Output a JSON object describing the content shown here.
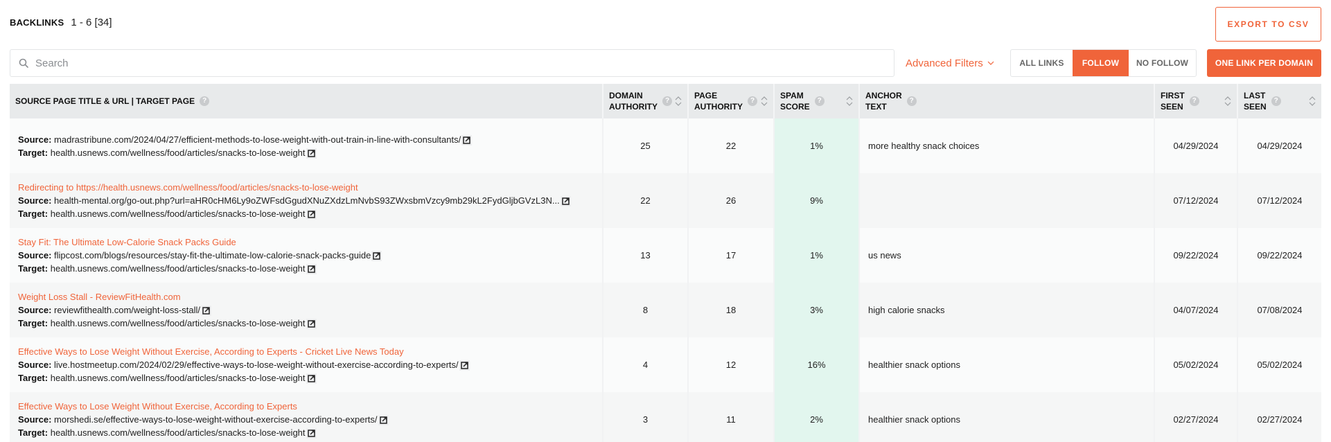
{
  "header": {
    "title": "BACKLINKS",
    "range": "1 - 6 [34]"
  },
  "toolbar": {
    "export_label": "EXPORT TO CSV",
    "search_placeholder": "Search",
    "search_value": "",
    "advanced_filters_label": "Advanced Filters",
    "link_filter": {
      "options": [
        "ALL LINKS",
        "FOLLOW",
        "NO FOLLOW"
      ],
      "selected": "FOLLOW"
    },
    "one_link_label": "ONE LINK PER DOMAIN"
  },
  "colors": {
    "accent": "#f0643a",
    "header_bg": "#e8eaeb",
    "spam_col_bg": "#e2f6ee"
  },
  "table": {
    "columns": [
      {
        "label": "SOURCE PAGE TITLE & URL | TARGET PAGE",
        "help": true,
        "sortable": false
      },
      {
        "label_1": "DOMAIN",
        "label_2": "AUTHORITY",
        "help": true,
        "sortable": true
      },
      {
        "label_1": "PAGE",
        "label_2": "AUTHORITY",
        "help": true,
        "sortable": true
      },
      {
        "label_1": "SPAM",
        "label_2": "SCORE",
        "help": true,
        "sortable": true
      },
      {
        "label_1": "ANCHOR",
        "label_2": "TEXT",
        "help": true,
        "sortable": false
      },
      {
        "label_1": "FIRST",
        "label_2": "SEEN",
        "help": true,
        "sortable": true
      },
      {
        "label_1": "LAST",
        "label_2": "SEEN",
        "help": true,
        "sortable": true
      }
    ],
    "source_label": "Source:",
    "target_label": "Target:",
    "rows": [
      {
        "title": "",
        "source": "madrastribune.com/2024/04/27/efficient-methods-to-lose-weight-with-out-train-in-line-with-consultants/",
        "target": "health.usnews.com/wellness/food/articles/snacks-to-lose-weight",
        "domain_authority": "25",
        "page_authority": "22",
        "spam_score": "1%",
        "anchor_text": "more healthy snack choices",
        "first_seen": "04/29/2024",
        "last_seen": "04/29/2024"
      },
      {
        "title": "Redirecting to https://health.usnews.com/wellness/food/articles/snacks-to-lose-weight",
        "source": "health-mental.org/go-out.php?url=aHR0cHM6Ly9oZWFsdGgudXNuZXdzLmNvbS93ZWxsbmVzcy9mb29kL2FydGljbGVzL3N...",
        "target": "health.usnews.com/wellness/food/articles/snacks-to-lose-weight",
        "domain_authority": "22",
        "page_authority": "26",
        "spam_score": "9%",
        "anchor_text": "",
        "first_seen": "07/12/2024",
        "last_seen": "07/12/2024"
      },
      {
        "title": "Stay Fit: The Ultimate Low-Calorie Snack Packs Guide",
        "source": "flipcost.com/blogs/resources/stay-fit-the-ultimate-low-calorie-snack-packs-guide",
        "target": "health.usnews.com/wellness/food/articles/snacks-to-lose-weight",
        "domain_authority": "13",
        "page_authority": "17",
        "spam_score": "1%",
        "anchor_text": "us news",
        "first_seen": "09/22/2024",
        "last_seen": "09/22/2024"
      },
      {
        "title": "Weight Loss Stall - ReviewFitHealth.com",
        "source": "reviewfithealth.com/weight-loss-stall/",
        "target": "health.usnews.com/wellness/food/articles/snacks-to-lose-weight",
        "domain_authority": "8",
        "page_authority": "18",
        "spam_score": "3%",
        "anchor_text": "high calorie snacks",
        "first_seen": "04/07/2024",
        "last_seen": "07/08/2024"
      },
      {
        "title": "Effective Ways to Lose Weight Without Exercise, According to Experts - Cricket Live News Today",
        "source": "live.hostmeetup.com/2024/02/29/effective-ways-to-lose-weight-without-exercise-according-to-experts/",
        "target": "health.usnews.com/wellness/food/articles/snacks-to-lose-weight",
        "domain_authority": "4",
        "page_authority": "12",
        "spam_score": "16%",
        "anchor_text": "healthier snack options",
        "first_seen": "05/02/2024",
        "last_seen": "05/02/2024"
      },
      {
        "title": "Effective Ways to Lose Weight Without Exercise, According to Experts",
        "source": "morshedi.se/effective-ways-to-lose-weight-without-exercise-according-to-experts/",
        "target": "health.usnews.com/wellness/food/articles/snacks-to-lose-weight",
        "domain_authority": "3",
        "page_authority": "11",
        "spam_score": "2%",
        "anchor_text": "healthier snack options",
        "first_seen": "02/27/2024",
        "last_seen": "02/27/2024"
      }
    ]
  }
}
